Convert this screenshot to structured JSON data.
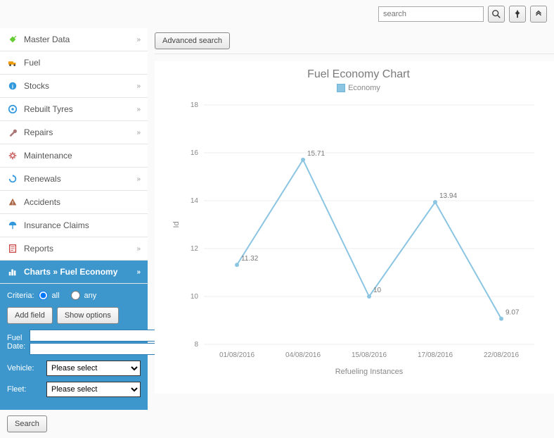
{
  "topbar": {
    "search_placeholder": "search"
  },
  "sidebar": {
    "items": [
      {
        "label": "Master Data",
        "icon": "pin",
        "color": "#6c3",
        "expand": true
      },
      {
        "label": "Fuel",
        "icon": "truck",
        "color": "#e90",
        "expand": false
      },
      {
        "label": "Stocks",
        "icon": "info",
        "color": "#39d",
        "expand": true
      },
      {
        "label": "Rebuilt Tyres",
        "icon": "tyre",
        "color": "#39d",
        "expand": true
      },
      {
        "label": "Repairs",
        "icon": "wrench",
        "color": "#a77",
        "expand": true
      },
      {
        "label": "Maintenance",
        "icon": "gear",
        "color": "#c66",
        "expand": false
      },
      {
        "label": "Renewals",
        "icon": "renew",
        "color": "#39d",
        "expand": true
      },
      {
        "label": "Accidents",
        "icon": "warn",
        "color": "#a64",
        "expand": false
      },
      {
        "label": "Insurance Claims",
        "icon": "umbrella",
        "color": "#39d",
        "expand": false
      },
      {
        "label": "Reports",
        "icon": "report",
        "color": "#c44",
        "expand": true
      }
    ],
    "active": {
      "label": "Charts » Fuel Economy"
    }
  },
  "filter": {
    "criteria_label": "Criteria:",
    "radio_all": "all",
    "radio_any": "any",
    "add_field": "Add field",
    "show_options": "Show options",
    "fuel_date_label": "Fuel Date:",
    "vehicle_label": "Vehicle:",
    "fleet_label": "Fleet:",
    "select_placeholder": "Please select",
    "search_btn": "Search"
  },
  "main": {
    "advanced_search": "Advanced search"
  },
  "chart_data": {
    "type": "line",
    "title": "Fuel Economy Chart",
    "legend": "Economy",
    "xlabel": "Refueling Instances",
    "ylabel": "Id",
    "categories": [
      "01/08/2016",
      "04/08/2016",
      "15/08/2016",
      "17/08/2016",
      "22/08/2016"
    ],
    "values": [
      11.32,
      15.71,
      10,
      13.94,
      9.07
    ],
    "ylim": [
      8,
      18
    ],
    "yticks": [
      8,
      10,
      12,
      14,
      16,
      18
    ]
  }
}
